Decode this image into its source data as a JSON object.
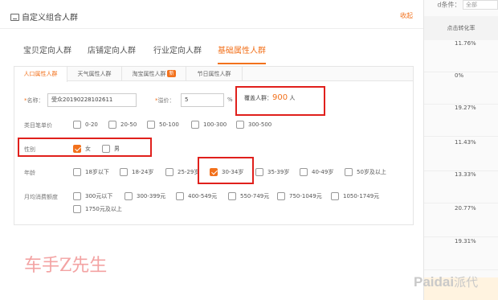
{
  "dialog": {
    "title": "自定义组合人群",
    "collapse_label": "收起",
    "main_tabs": [
      {
        "label": "宝贝定向人群"
      },
      {
        "label": "店铺定向人群"
      },
      {
        "label": "行业定向人群"
      },
      {
        "label": "基础属性人群",
        "active": true
      }
    ],
    "sub_tabs": [
      {
        "label": "人口属性人群",
        "active": true
      },
      {
        "label": "天气属性人群"
      },
      {
        "label": "淘宝属性人群",
        "badge": "新"
      },
      {
        "label": "节日属性人群"
      }
    ],
    "form": {
      "name_label": "名称：",
      "name_value": "受众20190228102611",
      "premium_label": "溢价：",
      "premium_value": "5",
      "premium_unit": "%",
      "coverage_label": "覆盖人群：",
      "coverage_value": "900",
      "coverage_unit": "人"
    },
    "category_price": {
      "label": "类目笔单价",
      "options": [
        "0-20",
        "20-50",
        "50-100",
        "100-300",
        "300-500"
      ]
    },
    "gender": {
      "label": "性别",
      "options": [
        {
          "label": "女",
          "checked": true
        },
        {
          "label": "男",
          "checked": false
        }
      ]
    },
    "age": {
      "label": "年龄",
      "options": [
        {
          "label": "18岁以下",
          "checked": false
        },
        {
          "label": "18-24岁",
          "checked": false
        },
        {
          "label": "25-29岁",
          "checked": false
        },
        {
          "label": "30-34岁",
          "checked": true
        },
        {
          "label": "35-39岁",
          "checked": false
        },
        {
          "label": "40-49岁",
          "checked": false
        },
        {
          "label": "50岁及以上",
          "checked": false
        }
      ]
    },
    "spending": {
      "label": "月均消费额度",
      "options": [
        "300元以下",
        "300-399元",
        "400-549元",
        "550-749元",
        "750-1049元",
        "1050-1749元",
        "1750元及以上"
      ]
    }
  },
  "background": {
    "top_label": "d条件：",
    "top_select": "全部",
    "column_header": "点击转化率",
    "rows": [
      "11.76%",
      "0%",
      "19.27%",
      "11.43%",
      "13.33%",
      "20.77%",
      "19.31%"
    ]
  },
  "watermark": "车手Z先生",
  "logo": {
    "latin": "Paidai",
    "cn": "派代"
  }
}
